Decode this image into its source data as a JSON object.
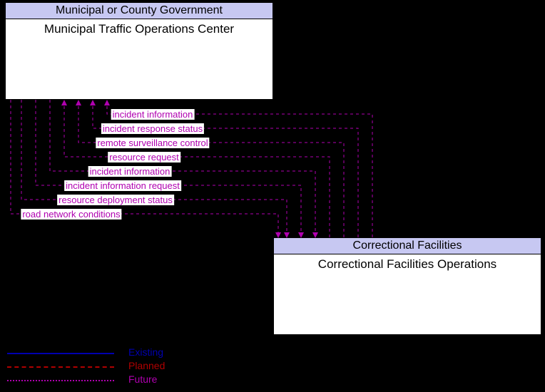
{
  "entities": {
    "a": {
      "header": "Municipal or County Government",
      "body": "Municipal Traffic Operations Center"
    },
    "b": {
      "header": "Correctional Facilities",
      "body": "Correctional Facilities Operations"
    }
  },
  "flows": {
    "f0": "incident information",
    "f1": "incident response status",
    "f2": "remote surveillance control",
    "f3": "resource request",
    "f4": "incident information",
    "f5": "incident information request",
    "f6": "resource deployment status",
    "f7": "road network conditions"
  },
  "legend": {
    "existing": "Existing",
    "planned": "Planned",
    "future": "Future"
  },
  "colors": {
    "future": "#b000b0",
    "existing": "#0000b0",
    "planned": "#b00000",
    "header_bg": "#c7c8f2"
  },
  "chart_data": {
    "type": "diagram",
    "nodes": [
      {
        "id": "A",
        "owner": "Municipal or County Government",
        "name": "Municipal Traffic Operations Center"
      },
      {
        "id": "B",
        "owner": "Correctional Facilities",
        "name": "Correctional Facilities Operations"
      }
    ],
    "edges": [
      {
        "from": "B",
        "to": "A",
        "label": "incident information",
        "status": "Future"
      },
      {
        "from": "B",
        "to": "A",
        "label": "incident response status",
        "status": "Future"
      },
      {
        "from": "B",
        "to": "A",
        "label": "remote surveillance control",
        "status": "Future"
      },
      {
        "from": "B",
        "to": "A",
        "label": "resource request",
        "status": "Future"
      },
      {
        "from": "A",
        "to": "B",
        "label": "incident information",
        "status": "Future"
      },
      {
        "from": "A",
        "to": "B",
        "label": "incident information request",
        "status": "Future"
      },
      {
        "from": "A",
        "to": "B",
        "label": "resource deployment status",
        "status": "Future"
      },
      {
        "from": "A",
        "to": "B",
        "label": "road network conditions",
        "status": "Future"
      }
    ],
    "legend_statuses": [
      "Existing",
      "Planned",
      "Future"
    ]
  }
}
